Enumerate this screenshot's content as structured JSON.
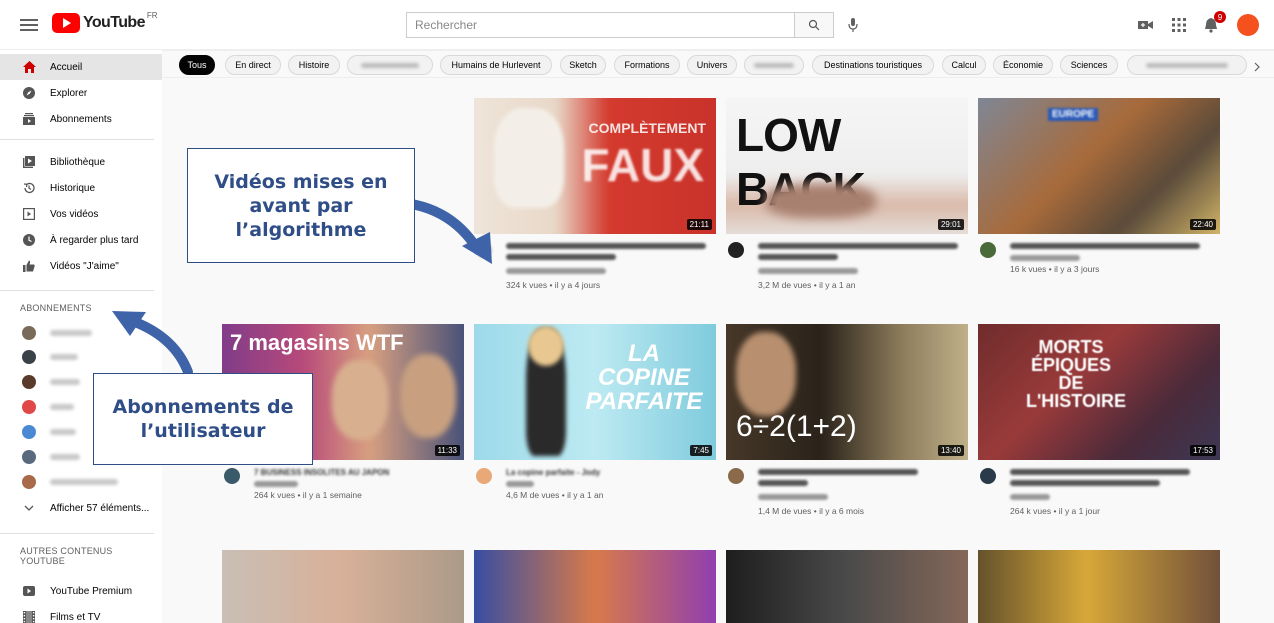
{
  "header": {
    "logo_text": "YouTube",
    "country_code": "FR",
    "search_placeholder": "Rechercher",
    "notification_count": "9",
    "icons": [
      "menu-icon",
      "search-icon",
      "mic-icon",
      "create-video-icon",
      "apps-grid-icon",
      "bell-icon"
    ]
  },
  "sidebar": {
    "main_items": [
      {
        "label": "Accueil",
        "icon": "home-icon",
        "active": true
      },
      {
        "label": "Explorer",
        "icon": "compass-icon"
      },
      {
        "label": "Abonnements",
        "icon": "subscriptions-icon"
      }
    ],
    "library_items": [
      {
        "label": "Bibliothèque",
        "icon": "library-icon"
      },
      {
        "label": "Historique",
        "icon": "history-icon"
      },
      {
        "label": "Vos vidéos",
        "icon": "play-square-icon"
      },
      {
        "label": "À regarder plus tard",
        "icon": "clock-icon"
      },
      {
        "label": "Vidéos \"J'aime\"",
        "icon": "thumbs-up-icon"
      }
    ],
    "subscriptions_heading": "ABONNEMENTS",
    "show_more": "Afficher 57 éléments...",
    "other_heading": "AUTRES CONTENUS YOUTUBE",
    "other_items": [
      {
        "label": "YouTube Premium",
        "icon": "youtube-premium-icon"
      },
      {
        "label": "Films et TV",
        "icon": "film-icon"
      }
    ]
  },
  "chips": [
    "Tous",
    "En direct",
    "Histoire",
    "",
    "Humains de Hurlevent",
    "Sketch",
    "Formations",
    "Univers",
    "",
    "Destinations touristiques",
    "Calcul",
    "Économie",
    "Sciences",
    ""
  ],
  "videos": [
    {
      "duration": "21:11",
      "thumb_text": "COMPLÈTEMENT FAUX",
      "views": "324 k vues • il y a 4 jours"
    },
    {
      "duration": "29:01",
      "thumb_text": "LOW BACK",
      "views": "3,2 M de vues • il y a 1 an"
    },
    {
      "duration": "22:40",
      "thumb_text": "EUROPE",
      "views": "16 k vues • il y a 3 jours"
    },
    {
      "duration": "11:33",
      "thumb_text": "7 magasins WTF",
      "title": "7 BUSINESS INSOLITES AU JAPON",
      "views": "264 k vues • il y a 1 semaine"
    },
    {
      "duration": "7:45",
      "thumb_text": "LA COPINE PARFAITE",
      "title": "La copine parfaite - Jody",
      "views": "4,6 M de vues • il y a 1 an"
    },
    {
      "duration": "13:40",
      "thumb_text": "6÷2(1+2)",
      "views": "1,4 M de vues • il y a 6 mois"
    },
    {
      "duration": "17:53",
      "thumb_text": "MORTS ÉPIQUES DE L'HISTOIRE",
      "views": "264 k vues • il y a 1 jour"
    }
  ],
  "annotations": {
    "algo": "Vidéos mises en avant par l’algorithme",
    "subs": "Abonnements de l’utilisateur"
  }
}
